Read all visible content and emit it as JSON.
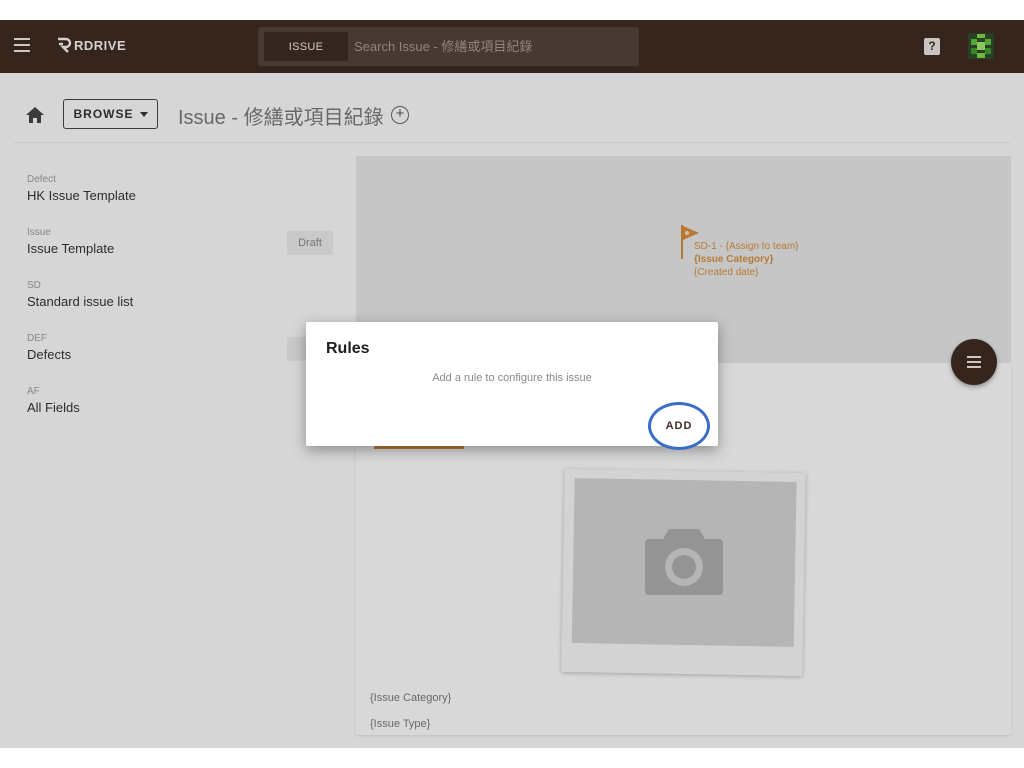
{
  "topbar": {
    "logo_text": "RDRIVE",
    "search_chip": "ISSUE",
    "search_placeholder": "Search Issue - 修繕或項目紀錄",
    "help_label": "?"
  },
  "header": {
    "browse_label": "BROWSE",
    "page_title": "Issue - 修繕或項目紀錄"
  },
  "sidebar": {
    "items": [
      {
        "code": "Defect",
        "name": "HK Issue Template",
        "badge": ""
      },
      {
        "code": "Issue",
        "name": "Issue Template",
        "badge": "Draft"
      },
      {
        "code": "SD",
        "name": "Standard issue list",
        "badge": ""
      },
      {
        "code": "DEF",
        "name": "Defects",
        "badge": "D"
      },
      {
        "code": "AF",
        "name": "All Fields",
        "badge": ""
      }
    ]
  },
  "card": {
    "badge_line1": "SD-1 - {Assign to team}",
    "badge_line2": "{Issue Category}",
    "badge_line3": "{Created date}",
    "label_category": "{Issue Category}",
    "label_type": "{Issue Type}"
  },
  "dialog": {
    "title": "Rules",
    "message": "Add a rule to configure this issue",
    "add_label": "ADD"
  },
  "colors": {
    "brand": "#3d2b22",
    "accent_orange": "#d08b3e",
    "highlight_ring": "#3b6cc7"
  }
}
